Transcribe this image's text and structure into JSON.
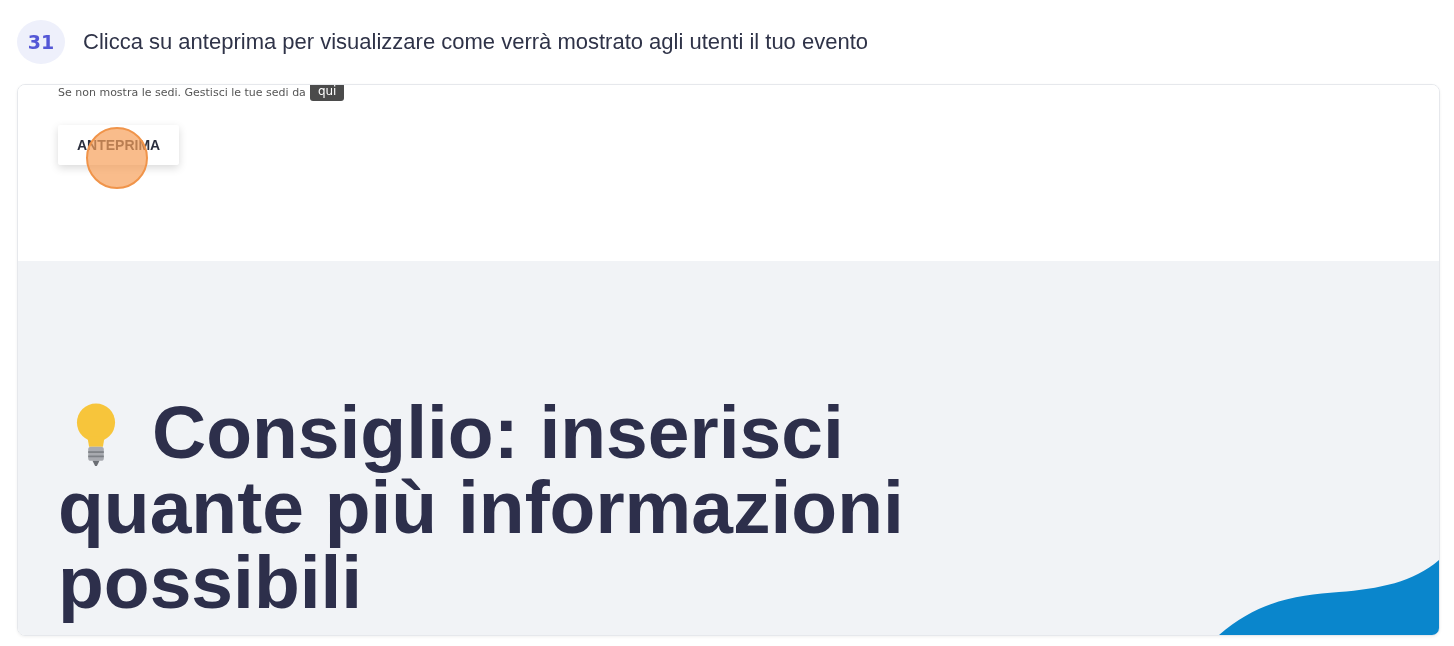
{
  "step": {
    "number": "31",
    "instruction": "Clicca su anteprima per visualizzare come verrà mostrato agli utenti il tuo evento"
  },
  "screenshot": {
    "note": "Se non mostra le sedi. Gestisci le tue sedi da",
    "link": "qui",
    "button": "ANTEPRIMA",
    "click_marker": true,
    "tip": {
      "lines": [
        "Consiglio: inserisci",
        "quante più informazioni",
        "possibili"
      ]
    }
  }
}
